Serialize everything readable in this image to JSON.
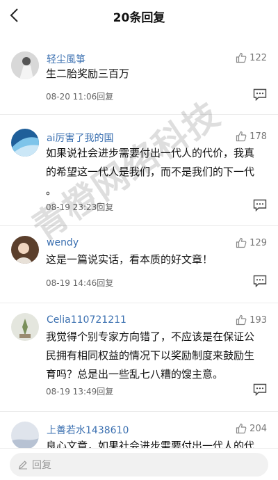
{
  "header": {
    "title": "20条回复",
    "back_icon": "chevron-left-icon"
  },
  "comments": [
    {
      "user": "轻尘風箏",
      "likes": "122",
      "text_lines": [
        "生二胎奖励三百万"
      ],
      "time": "08-20 11:06",
      "reply_label": "回复",
      "avatar_color": "#c9c9c9"
    },
    {
      "user": "ai厉害了我的国",
      "likes": "178",
      "text_lines": [
        "如果说社会进步需要付出一代人的代价，我真",
        "的希望这一代人是我们，而不是我们的下一代",
        "。"
      ],
      "time": "08-19 23:23",
      "reply_label": "回复",
      "avatar_color": "#2e7bbd"
    },
    {
      "user": "wendy",
      "likes": "129",
      "text_lines": [
        "这是一篇说实话，看本质的好文章！"
      ],
      "time": "08-19 14:46",
      "reply_label": "回复",
      "avatar_color": "#6b4a33"
    },
    {
      "user": "Celia110721211",
      "likes": "193",
      "text_lines": [
        "我觉得个别专家方向错了，不应该是在保证公",
        "民拥有相同权益的情况下以奖励制度来鼓励生",
        "育吗？总是出一些乱七八糟的馊主意。"
      ],
      "time": "08-19 13:49",
      "reply_label": "回复",
      "avatar_color": "#d9dcd0"
    },
    {
      "user": "上善若水1438610",
      "likes": "204",
      "text_lines": [
        "良心文章，如果社会进步需要付出一代人的代"
      ],
      "time": "",
      "reply_label": "",
      "avatar_color": "#b7c2d3"
    }
  ],
  "bottom": {
    "placeholder": "回复"
  },
  "watermark": "青橙网络科技"
}
